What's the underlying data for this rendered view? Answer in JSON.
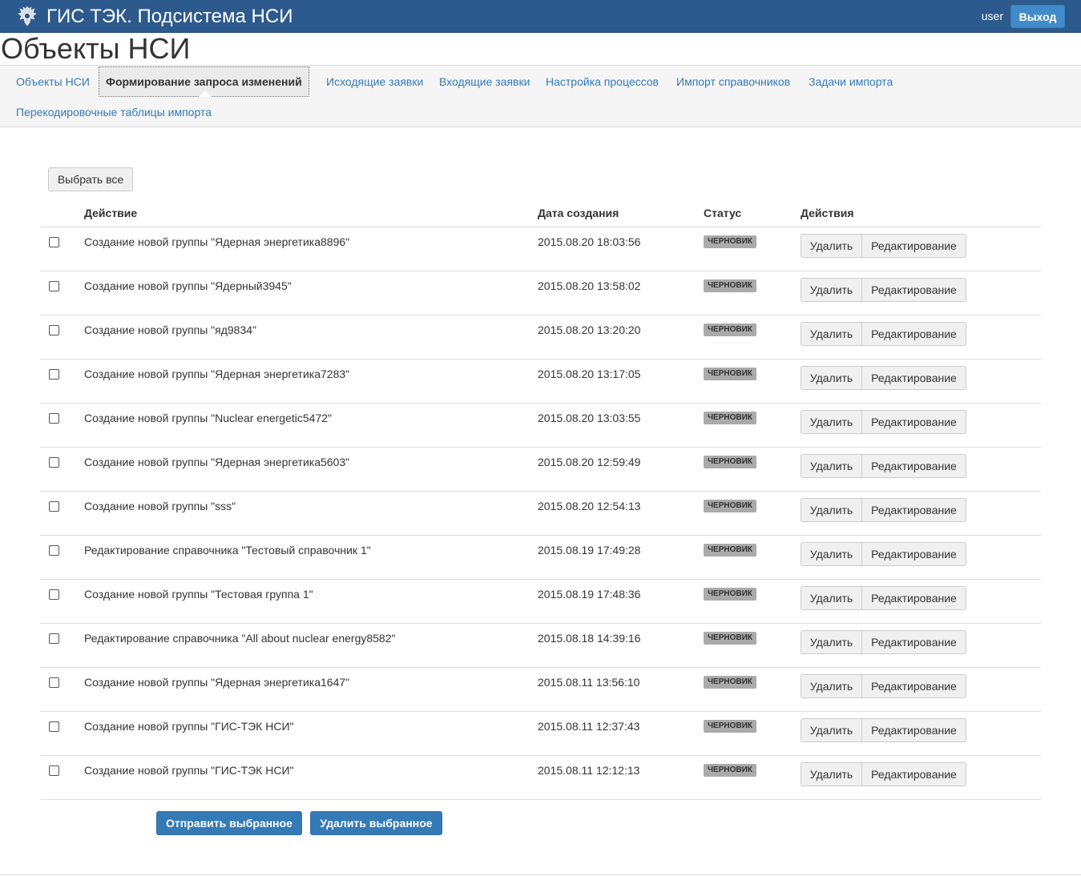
{
  "header": {
    "app_title": "ГИС ТЭК. Подсистема НСИ",
    "user": "user",
    "logout_label": "Выход",
    "emblem_icon": "coat-of-arms-icon"
  },
  "page_title": "Объекты НСИ",
  "nav": {
    "items": [
      {
        "label": "Объекты НСИ",
        "active": false
      },
      {
        "label": "Формирование запроса изменений",
        "active": true
      },
      {
        "label": "Исходящие заявки",
        "active": false
      },
      {
        "label": "Входящие заявки",
        "active": false
      },
      {
        "label": "Настройка процессов",
        "active": false
      },
      {
        "label": "Импорт справочников",
        "active": false
      },
      {
        "label": "Задачи импорта",
        "active": false
      },
      {
        "label": "Перекодировочные таблицы импорта",
        "active": false
      }
    ]
  },
  "select_all_label": "Выбрать все",
  "table": {
    "headers": {
      "action": "Действие",
      "date": "Дата создания",
      "status": "Статус",
      "actions": "Действия"
    },
    "delete_label": "Удалить",
    "edit_label": "Редактирование",
    "rows": [
      {
        "action": "Создание новой группы \"Ядерная энергетика8896\"",
        "date": "2015.08.20 18:03:56",
        "status": "черновик"
      },
      {
        "action": "Создание новой группы \"Ядерный3945\"",
        "date": "2015.08.20 13:58:02",
        "status": "черновик"
      },
      {
        "action": "Создание новой группы \"яд9834\"",
        "date": "2015.08.20 13:20:20",
        "status": "черновик"
      },
      {
        "action": "Создание новой группы \"Ядерная энергетика7283\"",
        "date": "2015.08.20 13:17:05",
        "status": "черновик"
      },
      {
        "action": "Создание новой группы \"Nuclear energetic5472\"",
        "date": "2015.08.20 13:03:55",
        "status": "черновик"
      },
      {
        "action": "Создание новой группы \"Ядерная энергетика5603\"",
        "date": "2015.08.20 12:59:49",
        "status": "черновик"
      },
      {
        "action": "Создание новой группы \"sss\"",
        "date": "2015.08.20 12:54:13",
        "status": "черновик"
      },
      {
        "action": "Редактирование справочника \"Тестовый справочник 1\"",
        "date": "2015.08.19 17:49:28",
        "status": "черновик"
      },
      {
        "action": "Создание новой группы \"Тестовая группа 1\"",
        "date": "2015.08.19 17:48:36",
        "status": "черновик"
      },
      {
        "action": "Редактирование справочника \"All about nuclear energy8582\"",
        "date": "2015.08.18 14:39:16",
        "status": "черновик"
      },
      {
        "action": "Создание новой группы \"Ядерная энергетика1647\"",
        "date": "2015.08.11 13:56:10",
        "status": "черновик"
      },
      {
        "action": "Создание новой группы \"ГИС-ТЭК НСИ\"",
        "date": "2015.08.11 12:37:43",
        "status": "черновик"
      },
      {
        "action": "Создание новой группы \"ГИС-ТЭК НСИ\"",
        "date": "2015.08.11 12:12:13",
        "status": "черновик"
      }
    ]
  },
  "footer_buttons": {
    "send_selected": "Отправить выбранное",
    "delete_selected": "Удалить выбранное"
  },
  "colors": {
    "header_bg": "#2d5a8c",
    "primary": "#337ab7",
    "badge": "#aaaaaa"
  }
}
